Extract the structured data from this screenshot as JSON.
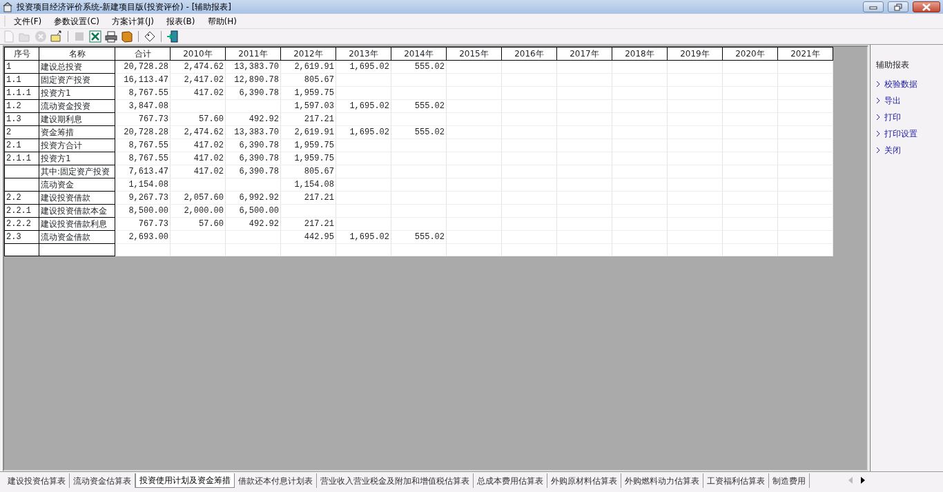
{
  "window": {
    "title": "投资项目经济评价系统-新建项目版(投资评价) - [辅助报表]"
  },
  "menu": [
    {
      "label": "文件(F)"
    },
    {
      "label": "参数设置(C)"
    },
    {
      "label": "方案计算(J)"
    },
    {
      "label": "报表(B)"
    },
    {
      "label": "帮助(H)"
    }
  ],
  "toolbar": [
    {
      "kind": "new",
      "disabled": true
    },
    {
      "kind": "open",
      "disabled": true
    },
    {
      "kind": "delete",
      "disabled": true
    },
    {
      "kind": "folder-up",
      "disabled": false
    },
    {
      "kind": "sep"
    },
    {
      "kind": "stop",
      "disabled": true
    },
    {
      "kind": "excel",
      "disabled": false
    },
    {
      "kind": "print",
      "disabled": false
    },
    {
      "kind": "book",
      "disabled": false
    },
    {
      "kind": "sep"
    },
    {
      "kind": "tag",
      "disabled": false
    },
    {
      "kind": "sep"
    },
    {
      "kind": "exit",
      "disabled": false
    }
  ],
  "table": {
    "columns": [
      "序号",
      "名称",
      "合计",
      "2010年",
      "2011年",
      "2012年",
      "2013年",
      "2014年",
      "2015年",
      "2016年",
      "2017年",
      "2018年",
      "2019年",
      "2020年",
      "2021年"
    ],
    "rows": [
      {
        "no": "1",
        "name": "建设总投资",
        "total": "20,728.28",
        "year_2010": "2,474.62",
        "year_2011": "13,383.70",
        "year_2012": "2,619.91",
        "year_2013": "1,695.02",
        "year_2014": "555.02"
      },
      {
        "no": "1.1",
        "name": "固定资产投资",
        "total": "16,113.47",
        "year_2010": "2,417.02",
        "year_2011": "12,890.78",
        "year_2012": "805.67"
      },
      {
        "no": "1.1.1",
        "name": "投资方1",
        "total": "8,767.55",
        "year_2010": "417.02",
        "year_2011": "6,390.78",
        "year_2012": "1,959.75"
      },
      {
        "no": "1.2",
        "name": "流动资金投资",
        "total": "3,847.08",
        "year_2012": "1,597.03",
        "year_2013": "1,695.02",
        "year_2014": "555.02"
      },
      {
        "no": "1.3",
        "name": "建设期利息",
        "total": "767.73",
        "year_2010": "57.60",
        "year_2011": "492.92",
        "year_2012": "217.21"
      },
      {
        "no": "2",
        "name": "资金筹措",
        "total": "20,728.28",
        "year_2010": "2,474.62",
        "year_2011": "13,383.70",
        "year_2012": "2,619.91",
        "year_2013": "1,695.02",
        "year_2014": "555.02"
      },
      {
        "no": "2.1",
        "name": "投资方合计",
        "total": "8,767.55",
        "year_2010": "417.02",
        "year_2011": "6,390.78",
        "year_2012": "1,959.75"
      },
      {
        "no": "2.1.1",
        "name": "投资方1",
        "total": "8,767.55",
        "year_2010": "417.02",
        "year_2011": "6,390.78",
        "year_2012": "1,959.75"
      },
      {
        "name": "其中:固定资产投资",
        "total": "7,613.47",
        "year_2010": "417.02",
        "year_2011": "6,390.78",
        "year_2012": "805.67"
      },
      {
        "name": "流动资金",
        "total": "1,154.08",
        "year_2012": "1,154.08"
      },
      {
        "no": "2.2",
        "name": "建设投资借款",
        "total": "9,267.73",
        "year_2010": "2,057.60",
        "year_2011": "6,992.92",
        "year_2012": "217.21"
      },
      {
        "no": "2.2.1",
        "name": "建设投资借款本金",
        "total": "8,500.00",
        "year_2010": "2,000.00",
        "year_2011": "6,500.00"
      },
      {
        "no": "2.2.2",
        "name": "建设投资借款利息",
        "total": "767.73",
        "year_2010": "57.60",
        "year_2011": "492.92",
        "year_2012": "217.21"
      },
      {
        "no": "2.3",
        "name": "流动资金借款",
        "total": "2,693.00",
        "year_2012": "442.95",
        "year_2013": "1,695.02",
        "year_2014": "555.02"
      }
    ]
  },
  "side_panel": {
    "title": "辅助报表",
    "links": [
      {
        "label": "校验数据"
      },
      {
        "label": "导出"
      },
      {
        "label": "打印"
      },
      {
        "label": "打印设置"
      },
      {
        "label": "关闭"
      }
    ]
  },
  "sheet_tabs": [
    {
      "label": "建设投资估算表",
      "selected": false
    },
    {
      "label": "流动资金估算表",
      "selected": false
    },
    {
      "label": "投资使用计划及资金筹措",
      "selected": true
    },
    {
      "label": "借款还本付息计划表",
      "selected": false
    },
    {
      "label": "营业收入营业税金及附加和增值税估算表",
      "selected": false
    },
    {
      "label": "总成本费用估算表",
      "selected": false
    },
    {
      "label": "外购原材料估算表",
      "selected": false
    },
    {
      "label": "外购燃料动力估算表",
      "selected": false
    },
    {
      "label": "工资福利估算表",
      "selected": false
    },
    {
      "label": "制造费用",
      "selected": false
    }
  ],
  "tab_scroll": {
    "back_enabled": false,
    "forward_enabled": true
  }
}
